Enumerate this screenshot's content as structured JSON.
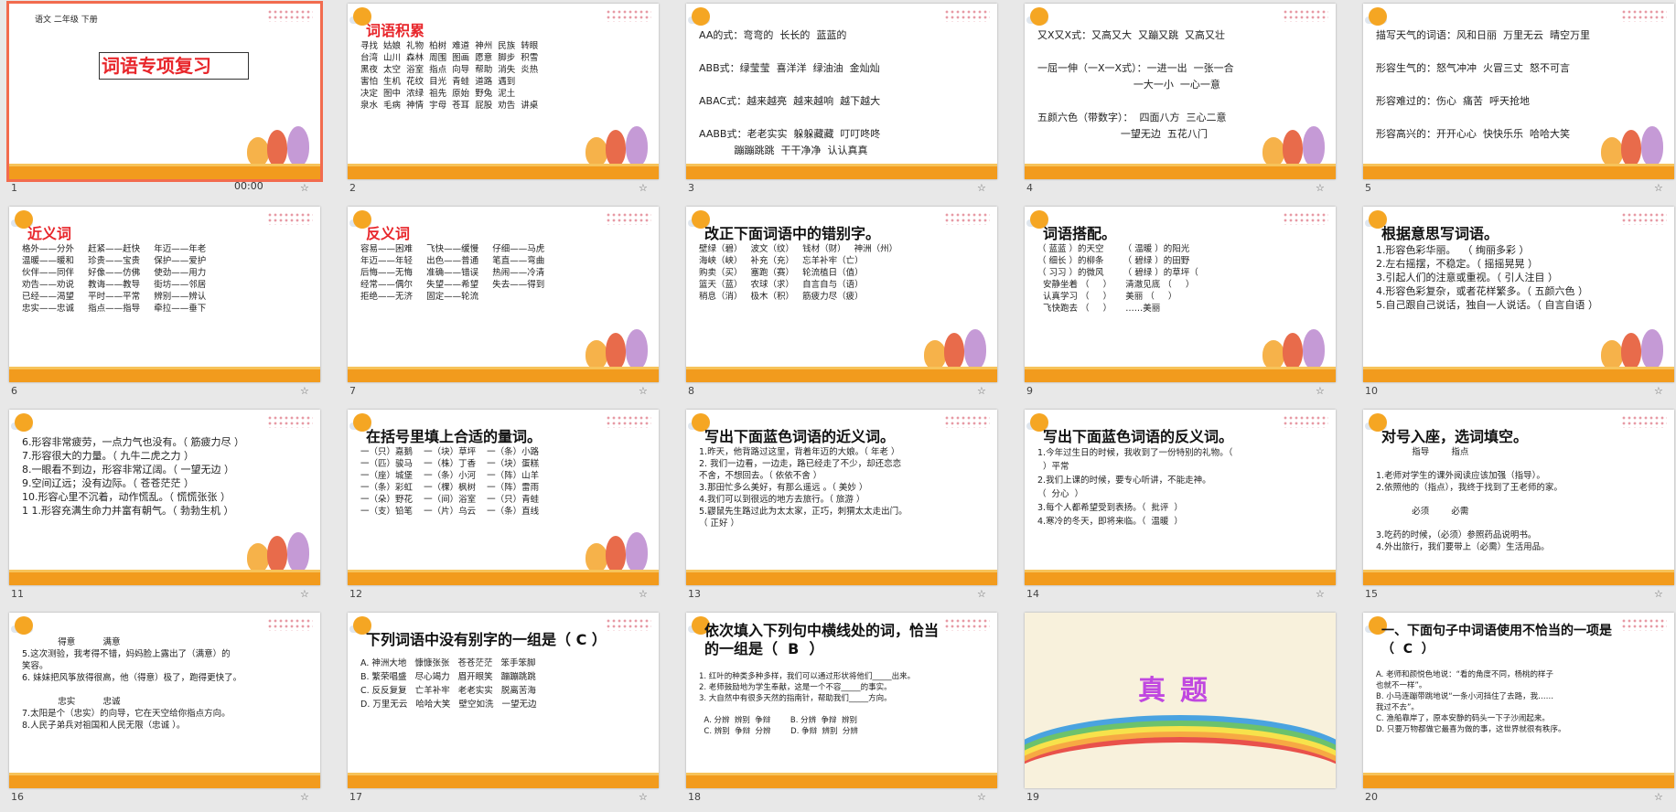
{
  "timer": "00:00",
  "slides": [
    {
      "num": "1",
      "header": "语文  二年级  下册",
      "title": "词语专项复习",
      "body": ""
    },
    {
      "num": "2",
      "title": "词语积累",
      "body": "寻找  姑娘  礼物  柏树  难道  神州  民族  转眼\n台湾  山川  森林  周围  图画  愿意  脚步  积雪\n黑夜  太空  浴室  指点  向导  帮助  消失  炎热\n害怕  生机  花纹  目光  青蛙  道路  遇到\n决定  图中  浓绿  祖先  原始  野兔  泥土\n泉水  毛病  神情  宇母  苍耳  屁股  劝告  讲桌"
    },
    {
      "num": "3",
      "title": "",
      "body": "AA的式：弯弯的  长长的  蓝蓝的\n\nABB式：绿莹莹  喜洋洋  绿油油  金灿灿\n\nABAC式：越来越亮  越来越响  越下越大\n\nAABB式：老老实实  躲躲藏藏  叮叮咚咚\n           蹦蹦跳跳  干干净净  认认真真"
    },
    {
      "num": "4",
      "title": "",
      "body": "又X又X式：又高又大  又蹦又跳  又高又壮\n\n一屈一伸（一X一X式）：一进一出  一张一合\n                              一大一小  一心一意\n\n五颜六色（带数字）：  四面八方  三心二意\n                          一望无边  五花八门"
    },
    {
      "num": "5",
      "title": "",
      "body": "描写天气的词语：风和日丽  万里无云  晴空万里\n\n形容生气的：怒气冲冲  火冒三丈  怒不可言\n\n形容难过的：伤心  痛苦  呼天抢地\n\n形容高兴的：开开心心  快快乐乐  哈哈大笑"
    },
    {
      "num": "6",
      "title": "近义词",
      "body": "格外——分外     赶紧——赶快     年迈——年老\n温暖——暖和     珍贵——宝贵     保护——爱护\n伙伴——同伴     好像——仿佛     使劲——用力\n劝告——劝说     教诲——教导     街坊——邻居\n已经——渴望     平时——平常     辨别——辨认\n忠实——忠诚     指点——指导     牵拉——垂下"
    },
    {
      "num": "7",
      "title": "反义词",
      "body": "容易——困难     飞快——缓慢     仔细——马虎\n年迈——年轻     出色——普通     笔直——弯曲\n后悔——无悔     准确——错误     热闹——冷清\n经常——偶尔     失望——希望     失去——得到\n拒绝——无济     固定——轮流"
    },
    {
      "num": "8",
      "title": "改正下面词语中的错别字。",
      "body": "壁绿（碧）   波文（纹）   钱材（财）   神洲（州）\n海峡（峡）   补充（充）   忘羊补牢（亡）\n购卖（买）   塞跑（赛）   轮流植日（值）\n篮天（蓝）   农球（求）   自言自与（语）\n稍息（消）   极木（积）   筋疲力尽（疲）"
    },
    {
      "num": "9",
      "title": "词语搭配。",
      "body": "（ 蓝蓝 ）的天空       （ 温暖 ）的阳光\n（ 细长 ）的柳条       （ 碧绿 ）的田野\n（ 习习 ）的微风       （ 碧绿 ）的草坪（\n  安静坐着 （     ）     清澈见底 （     ）\n  认真学习 （     ）     美丽 （     ）\n  飞快跑去 （     ）     ……美丽"
    },
    {
      "num": "10",
      "title": "根据意思写词语。",
      "body": "1.形容色彩华丽。  （ 绚丽多彩 ）\n2.左右摇摆，不稳定。（ 摇摇晃晃 ）\n3.引起人们的注意或重视。（ 引人注目 ）\n4.形容色彩复杂，或者花样繁多。（ 五颜六色 ）\n5.自己跟自己说话，独自一人说话。（ 自言自语 ）"
    },
    {
      "num": "11",
      "title": "",
      "body": "6.形容非常疲劳，一点力气也没有。（ 筋疲力尽 ）\n7.形容很大的力量。（ 九牛二虎之力 ）\n8.一眼看不到边，形容非常辽阔。（ 一望无边 ）\n9.空间辽远；没有边际。（ 苍苍茫茫 ）\n10.形容心里不沉着，动作慌乱。（ 慌慌张张 ）\n1 1.形容充满生命力并富有朝气。（ 勃勃生机 ）"
    },
    {
      "num": "12",
      "title": "在括号里填上合适的量词。",
      "body": "一（只）嘉鹅    一（块）草坪    一（条）小路\n一（匹）骏马    一（株）丁香    一（块）蛋糕\n一（座）城堡    一（条）小河    一（阵）山羊\n一（条）彩虹    一（棵）枫树    一（阵）雷雨\n一（朵）野花    一（间）浴室    一（只）青蛙\n一（支）铅笔    一（片）乌云    一（条）直线"
    },
    {
      "num": "13",
      "title": "写出下面蓝色词语的近义词。",
      "body": "1.昨天，他背路过这里，背着年迈的大娘。（ 年老 ）\n2. 我们一边看，一边走，路已经走了不少，却还恋恋\n不舍，不想回去。（ 依依不舍 ）\n3.那田忙多么美好，有那么遥远 。（ 美妙 ）\n4.我们可以到很远的地方去旅行。（ 旅游 ）\n5.鼹鼠先生路过此为太太家，正巧，刺猬太太走出门。\n（ 正好 ）"
    },
    {
      "num": "14",
      "title": "写出下面蓝色词语的反义词。",
      "body": "1.今年过生日的时候，我收到了一份特别的礼物。（\n  ）平常\n2.我们上课的时候，要专心听讲，不能走神。\n（  分心  ）\n3.每个人都希望受到表扬。（  批评  ）\n4.寒冷的冬天，即将来临。（  温暖  ）"
    },
    {
      "num": "15",
      "title": "对号入座，选词填空。",
      "body": "             指导        指点\n\n1.老师对学生的课外阅读应该加强（指导）。\n2.依照他的（指点），我终于找到了王老师的家。\n\n             必须        必需\n\n3.吃药的时候，（必须）参照药品说明书。\n4.外出旅行，我们要带上（必需）生活用品。"
    },
    {
      "num": "16",
      "title": "",
      "body": "             得意          满意\n5.这次测验，我考得不错，妈妈脸上露出了（满意）的\n笑容。\n6. 妹妹把风筝放得很高，他（得意）极了，跑得更快了。\n\n             忠实          忠诚\n7.太阳是个（忠实）的向导，它在天空给你指点方向。\n8.人民子弟兵对祖国和人民无限（忠诚 ）。"
    },
    {
      "num": "17",
      "title": "下列词语中没有别字的一组是（  C  ）",
      "body": "A. 神洲大地   慷慷张张   苍苍茫茫   笨手笨脚\nB. 繁荣唱盛   尽心竭力   眉开眼笑   蹦蹦跳跳\nC. 反反复复   亡羊补牢   老老实实   脱离苦海\nD. 万里无云   哈哈大笑   壁空如洗   一望无边"
    },
    {
      "num": "18",
      "title": "依次填入下列句中横线处的词，恰当\n的一组是（  B  ）",
      "body": "\n1. 红叶的种类多种多样，我们可以通过形状将他们_____出来。\n2. 老师鼓励地为学生奉献，这是一个不容_____的事实。\n3. 大自然中有很多天然的指南针，帮助我们_____方向。\n\n  A. 分辨  辨别  争辩        B. 分辨  争辩  辨别\n  C. 辨别  争辩  分辨        D. 争辩  辨别  分辨"
    },
    {
      "num": "19",
      "title": "真题",
      "body": ""
    },
    {
      "num": "20",
      "title": "一、下面句子中词语使用不恰当的一项是\n（  C  ）",
      "body": "\nA. 老师和颜悦色地说：“看的角度不同，杨桃的样子\n也就不一样”。\nB. 小马连蹦带跳地说“一条小河挡住了去路，我……\n我过不去”。\nC. 渔船靠岸了，原本安静的码头一下子沙闹起来。\nD. 只要万物都做它最喜为做的事，这世界就很有秩序。"
    }
  ]
}
